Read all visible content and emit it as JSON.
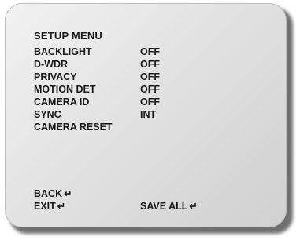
{
  "menu": {
    "title": "SETUP MENU",
    "items": [
      {
        "label": "BACKLIGHT",
        "value": "OFF"
      },
      {
        "label": "D-WDR",
        "value": "OFF"
      },
      {
        "label": "PRIVACY",
        "value": "OFF"
      },
      {
        "label": "MOTION DET",
        "value": "OFF"
      },
      {
        "label": "CAMERA ID",
        "value": "OFF"
      },
      {
        "label": "SYNC",
        "value": "INT"
      },
      {
        "label": "CAMERA RESET",
        "value": ""
      }
    ]
  },
  "footer": {
    "back_label": "BACK",
    "exit_label": "EXIT",
    "save_all_label": "SAVE ALL"
  },
  "icons": {
    "enter_glyph": "↵"
  },
  "colors": {
    "panel_light": "#f2f2f2",
    "panel_dark": "#d0d0d0",
    "text": "#1a1a1a"
  }
}
